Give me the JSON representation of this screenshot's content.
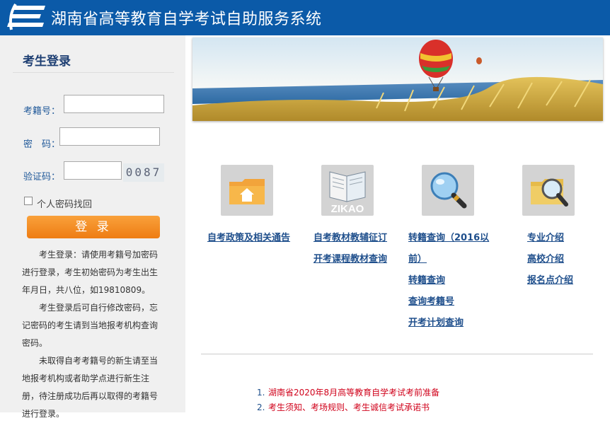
{
  "header": {
    "title": "湖南省高等教育自学考试自助服务系统"
  },
  "login": {
    "heading": "考生登录",
    "exam_no_label": "考籍号：",
    "password_label": "密　码：",
    "captcha_label": "验证码：",
    "captcha_text": "0087",
    "recover_label": "个人密码找回",
    "login_button": "登 录",
    "notes": [
      "考生登录：请使用考籍号加密码进行登录，考生初始密码为考生出生年月日，共八位，如19810809。",
      "考生登录后可自行修改密码，忘记密码的考生请到当地报考机构查询密码。",
      "未取得自考考籍号的新生请至当地报考机构或者助学点进行新生注册，待注册成功后再以取得的考籍号进行登录。"
    ]
  },
  "tiles": {
    "t1": {
      "icon": "folder-home-icon"
    },
    "t2": {
      "icon": "zikao-book-icon",
      "text": "ZIKAO"
    },
    "t3": {
      "icon": "magnifier-icon"
    },
    "t4": {
      "icon": "folder-search-icon"
    }
  },
  "links": {
    "c1": [
      "自考政策及相关通告"
    ],
    "c2": [
      "自考教材教辅征订",
      "开考课程教材查询"
    ],
    "c3_a": "转籍查询（2016以",
    "c3_b": "前）",
    "c3": [
      "转籍查询",
      "查询考籍号",
      "开考计划查询"
    ],
    "c4": [
      "专业介绍",
      "高校介绍",
      "报名点介绍"
    ]
  },
  "notices": [
    {
      "num": "1.",
      "text": "湖南省2020年8月高等教育自学考试考前准备"
    },
    {
      "num": "2.",
      "text": "考生须知、考场规则、考生诚信考试承诺书"
    }
  ]
}
